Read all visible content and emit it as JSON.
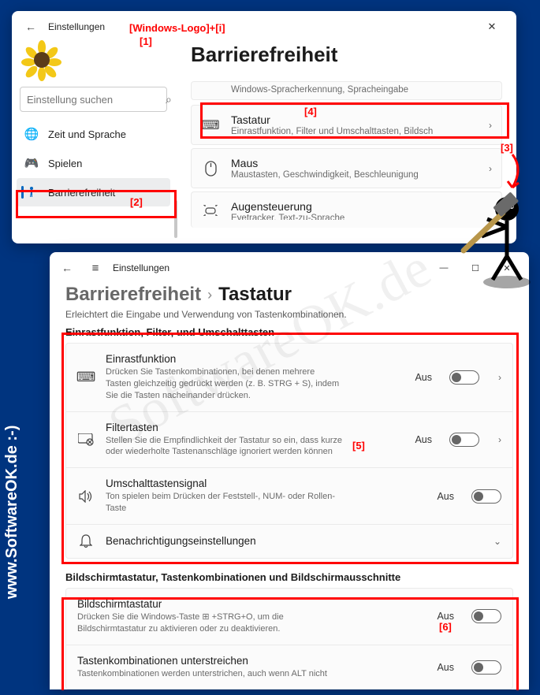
{
  "annotations": {
    "shortcut": "[Windows-Logo]+[i]",
    "n1": "[1]",
    "n2": "[2]",
    "n3": "[3]",
    "n4": "[4]",
    "n5": "[5]",
    "n6": "[6]"
  },
  "window1": {
    "title": "Einstellungen",
    "page_title": "Barrierefreiheit",
    "search_placeholder": "Einstellung suchen",
    "nav": {
      "time": "Zeit und Sprache",
      "gaming": "Spielen",
      "accessibility": "Barrierefreiheit"
    },
    "rows": {
      "peek_sub": "Windows-Spracherkennung, Spracheingabe",
      "keyboard": {
        "title": "Tastatur",
        "sub": "Einrastfunktion, Filter und Umschalttasten, Bildsch"
      },
      "mouse": {
        "title": "Maus",
        "sub": "Maustasten, Geschwindigkeit, Beschleunigung"
      },
      "eye": {
        "title": "Augensteuerung",
        "sub": "Eyetracker, Text-zu-Sprache"
      }
    }
  },
  "window2": {
    "title": "Einstellungen",
    "bc_parent": "Barrierefreiheit",
    "bc_current": "Tastatur",
    "desc": "Erleichtert die Eingabe und Verwendung von Tastenkombinationen.",
    "section1": "Einrastfunktion, Filter, und Umschalttasten",
    "sticky": {
      "title": "Einrastfunktion",
      "sub": "Drücken Sie Tastenkombinationen, bei denen mehrere Tasten gleichzeitig gedrückt werden (z. B. STRG + S), indem Sie die Tasten nacheinander drücken.",
      "state": "Aus"
    },
    "filter": {
      "title": "Filtertasten",
      "sub": "Stellen Sie die Empfindlichkeit der Tastatur so ein, dass kurze oder wiederholte Tastenanschläge ignoriert werden können",
      "state": "Aus"
    },
    "togglekeys": {
      "title": "Umschalttastensignal",
      "sub": "Ton spielen beim Drücken der Feststell-, NUM- oder Rollen-Taste",
      "state": "Aus"
    },
    "notifications": {
      "title": "Benachrichtigungseinstellungen"
    },
    "section2": "Bildschirmtastatur, Tastenkombinationen und Bildschirmausschnitte",
    "osk": {
      "title": "Bildschirmtastatur",
      "sub": "Drücken Sie die Windows-Taste ⊞ +STRG+O, um die Bildschirmtastatur zu aktivieren oder zu deaktivieren.",
      "state": "Aus"
    },
    "underline": {
      "title": "Tastenkombinationen unterstreichen",
      "sub": "Tastenkombinationen werden unterstrichen, auch wenn ALT nicht",
      "state": "Aus"
    }
  },
  "watermark": "SoftwareOK.de",
  "side_text": "www.SoftwareOK.de  :-)"
}
